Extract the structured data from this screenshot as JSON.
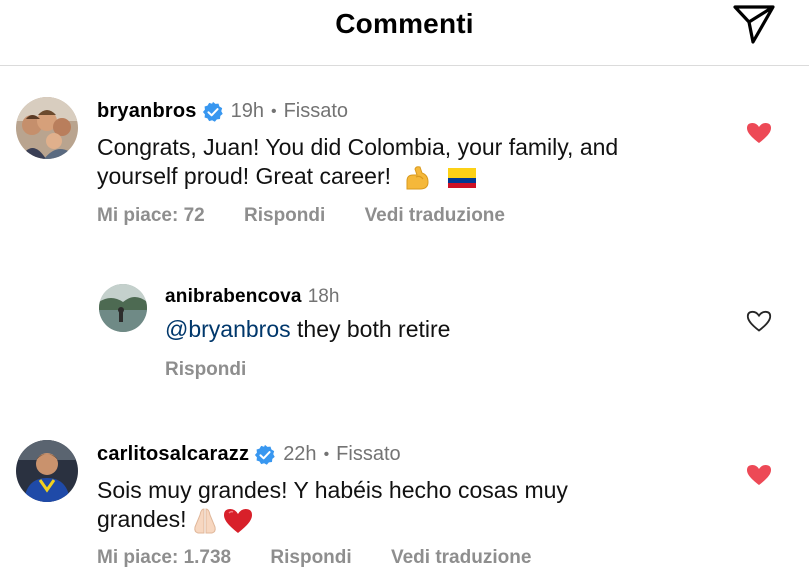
{
  "header": {
    "title": "Commenti"
  },
  "comments": [
    {
      "username": "bryanbros",
      "time": "19h",
      "pinned_label": "Fissato",
      "text": "Congrats, Juan! You did Colombia, your family, and yourself proud! Great career!",
      "likes_label": "Mi piace: 72",
      "reply_label": "Rispondi",
      "translate_label": "Vedi traduzione",
      "liked": true
    },
    {
      "username": "anibrabencova",
      "time": "18h",
      "mention": "@bryanbros",
      "text": " they both retire",
      "reply_label": "Rispondi",
      "liked": false
    },
    {
      "username": "carlitosalcarazz",
      "time": "22h",
      "pinned_label": "Fissato",
      "text": "Sois muy grandes! Y habéis hecho cosas muy grandes!",
      "likes_label": "Mi piace: 1.738",
      "reply_label": "Rispondi",
      "translate_label": "Vedi traduzione",
      "liked": true
    }
  ],
  "colors": {
    "heart_red": "#ed4956",
    "verified_blue": "#3897f0",
    "secondary_text": "#737373",
    "mention": "#00376b"
  },
  "icons": [
    "share-icon",
    "verified-badge-icon",
    "heart-filled-icon",
    "heart-outline-icon",
    "flexed-biceps-emoji",
    "colombia-flag-emoji",
    "folded-hands-emoji",
    "red-heart-emoji"
  ]
}
